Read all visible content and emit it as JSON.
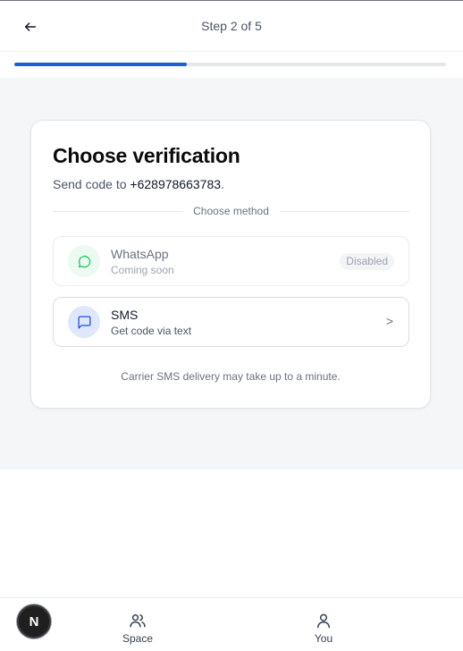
{
  "header": {
    "step_label": "Step 2 of 5",
    "progress_fraction": 0.4
  },
  "card": {
    "title": "Choose verification",
    "subtitle_prefix": "Send code to",
    "phone": "+628978663783",
    "subtitle_suffix": ".",
    "divider_label": "Choose method",
    "methods": [
      {
        "name": "WhatsApp",
        "desc": "Coming soon",
        "badge": "Disabled",
        "icon": "chat-bubble-icon",
        "state": "disabled",
        "accent": "#22c55e"
      },
      {
        "name": "SMS",
        "desc": "Get code via text",
        "chevron": ">",
        "icon": "message-square-icon",
        "state": "enabled",
        "accent": "#1d4ed8"
      }
    ],
    "note": "Carrier SMS delivery may take up to a minute."
  },
  "bottom_nav": {
    "items": [
      {
        "label": "Space",
        "icon": "users-icon"
      },
      {
        "label": "You",
        "icon": "user-icon"
      }
    ]
  },
  "fab": {
    "letter": "N"
  },
  "colors": {
    "accent": "#1d5fd6",
    "page_bg": "#f5f6f8"
  }
}
